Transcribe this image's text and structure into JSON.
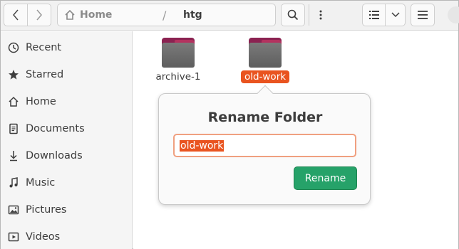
{
  "header": {
    "path_home": "Home",
    "path_separator": "/",
    "path_current": "htg",
    "icons": {
      "back": "chevron-left-icon",
      "forward": "chevron-right-icon",
      "home": "home-icon",
      "path_menu": "vertical-ellipsis-icon",
      "search": "search-icon",
      "list_view": "list-view-icon",
      "view_options": "chevron-down-icon",
      "main_menu": "hamburger-menu-icon"
    }
  },
  "sidebar": {
    "items": [
      {
        "label": "Recent",
        "icon": "clock-icon"
      },
      {
        "label": "Starred",
        "icon": "star-icon"
      },
      {
        "label": "Home",
        "icon": "home-icon"
      },
      {
        "label": "Documents",
        "icon": "document-icon"
      },
      {
        "label": "Downloads",
        "icon": "download-icon"
      },
      {
        "label": "Music",
        "icon": "music-note-icon"
      },
      {
        "label": "Pictures",
        "icon": "picture-icon"
      },
      {
        "label": "Videos",
        "icon": "video-icon"
      }
    ]
  },
  "files": [
    {
      "name": "archive-1",
      "selected": false
    },
    {
      "name": "old-work",
      "selected": true
    }
  ],
  "rename_popover": {
    "title": "Rename Folder",
    "input_value": "old-work",
    "button_label": "Rename"
  },
  "colors": {
    "accent": "#e95420",
    "rename_button": "#26a269",
    "folder_tab": "#8b2251",
    "folder_body": "#6e6e6e"
  }
}
